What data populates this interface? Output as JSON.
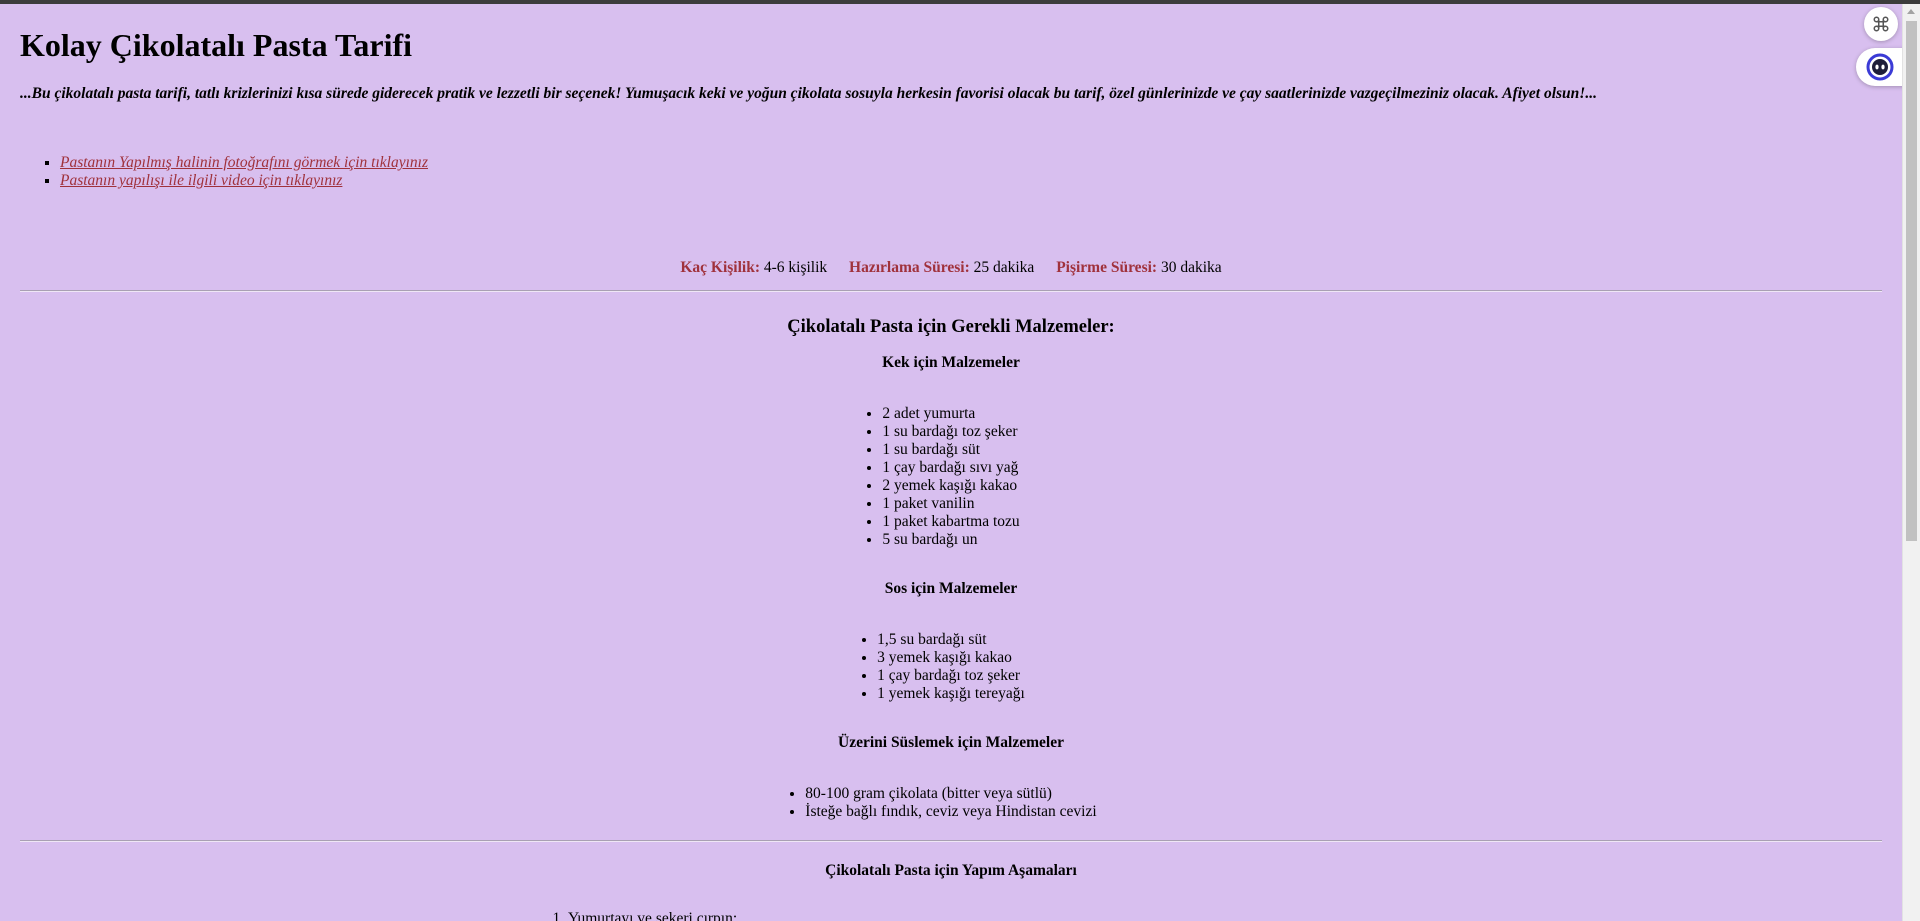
{
  "title": "Kolay Çikolatalı Pasta Tarifi",
  "intro": "...Bu çikolatalı pasta tarifi, tatlı krizlerinizi kısa sürede giderecek pratik ve lezzetli bir seçenek! Yumuşacık keki ve yoğun çikolata sosuyla herkesin favorisi olacak bu tarif, özel günlerinizde ve çay saatlerinizde vazgeçilmeziniz olacak. Afiyet olsun!...",
  "links": [
    "Pastanın Yapılmış halinin fotoğrafını görmek için tıklayınız",
    "Pastanın yapılışı ile ilgili video için tıklayınız"
  ],
  "meta": {
    "servings_label": "Kaç Kişilik:",
    "servings_value": "4-6 kişilik",
    "prep_label": "Hazırlama Süresi:",
    "prep_value": "25 dakika",
    "cook_label": "Pişirme Süresi:",
    "cook_value": "30 dakika"
  },
  "ingredients": {
    "heading": "Çikolatalı Pasta için Gerekli Malzemeler:",
    "cake": {
      "heading": "Kek için Malzemeler",
      "items": [
        "2 adet yumurta",
        "1 su bardağı toz şeker",
        "1 su bardağı süt",
        "1 çay bardağı sıvı yağ",
        "2 yemek kaşığı kakao",
        "1 paket vanilin",
        "1 paket kabartma tozu",
        "5 su bardağı un"
      ]
    },
    "sauce": {
      "heading": "Sos için Malzemeler",
      "items": [
        "1,5 su bardağı süt",
        "3 yemek kaşığı kakao",
        "1 çay bardağı toz şeker",
        "1 yemek kaşığı tereyağı"
      ]
    },
    "topping": {
      "heading": "Üzerini Süslemek için Malzemeler",
      "items": [
        "80-100 gram çikolata (bitter veya sütlü)",
        "İsteğe bağlı fındık, ceviz veya Hindistan cevizi"
      ]
    }
  },
  "steps": {
    "heading": "Çikolatalı Pasta için Yapım Aşamaları",
    "items": [
      "Yumurtayı ve şekeri çırpın;"
    ]
  },
  "icons": {
    "shortcut": "command-icon",
    "assistant": "assistant-face-icon"
  },
  "colors": {
    "background": "#d8bfef",
    "label_accent": "#a0323c"
  }
}
